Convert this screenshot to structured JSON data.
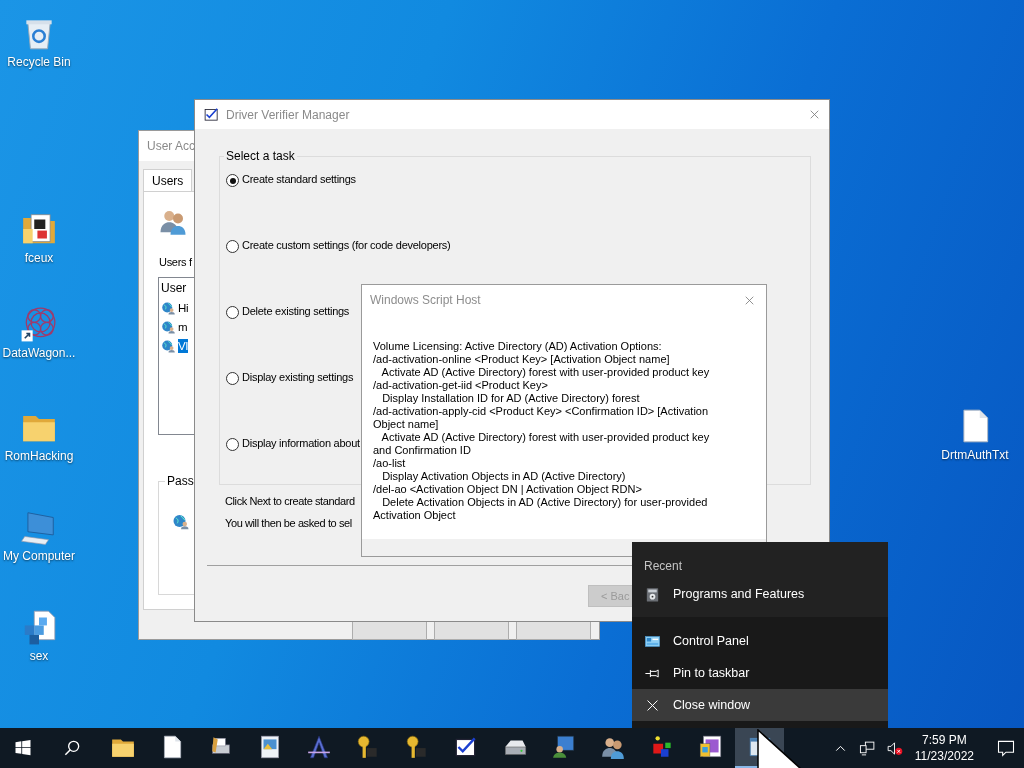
{
  "desktop_icons": [
    {
      "label": "Recycle Bin",
      "kind": "recycle-bin"
    },
    {
      "label": "fceux",
      "kind": "folder-doc"
    },
    {
      "label": "DataWagon...",
      "kind": "web-shortcut"
    },
    {
      "label": "RomHacking",
      "kind": "folder"
    },
    {
      "label": "My Computer",
      "kind": "computer"
    },
    {
      "label": "sex",
      "kind": "registry"
    },
    {
      "label": "DrtmAuthTxt",
      "kind": "file"
    }
  ],
  "user_accounts": {
    "title": "User Acc",
    "tabs": [
      {
        "label": "Users",
        "selected": true
      }
    ],
    "users_label": "Users f",
    "list": {
      "header": "User",
      "rows": [
        {
          "name": "Hi",
          "selected": false
        },
        {
          "name": "m",
          "selected": false
        },
        {
          "name": "VI",
          "selected": true
        }
      ]
    },
    "password_group": "Pass"
  },
  "driver_verifier": {
    "title": "Driver Verifier Manager",
    "group_label": "Select a task",
    "options": [
      {
        "label": "Create standard settings",
        "selected": true
      },
      {
        "label": "Create custom settings (for code developers)",
        "selected": false
      },
      {
        "label": "Delete existing settings",
        "selected": false
      },
      {
        "label": "Display existing settings",
        "selected": false
      },
      {
        "label": "Display information about",
        "selected": false
      }
    ],
    "notes": [
      "Click Next to create standard",
      "You will then be asked to sel"
    ],
    "back_button": {
      "label": "< Bac",
      "disabled": true
    }
  },
  "script_host": {
    "title": "Windows Script Host",
    "message": "Volume Licensing: Active Directory (AD) Activation Options:\n/ad-activation-online <Product Key> [Activation Object name]\n   Activate AD (Active Directory) forest with user-provided product key\n/ad-activation-get-iid <Product Key>\n   Display Installation ID for AD (Active Directory) forest\n/ad-activation-apply-cid <Product Key> <Confirmation ID> [Activation\nObject name]\n   Activate AD (Active Directory) forest with user-provided product key\nand Confirmation ID\n/ao-list\n   Display Activation Objects in AD (Active Directory)\n/del-ao <Activation Object DN | Activation Object RDN>\n   Delete Activation Objects in AD (Active Directory) for user-provided\nActivation Object"
  },
  "jump_list": {
    "heading": "Recent",
    "recent": [
      {
        "label": "Programs and Features",
        "kind": "programs"
      }
    ],
    "tasks": [
      {
        "label": "Control Panel",
        "kind": "control-panel",
        "selected": false
      },
      {
        "label": "Pin to taskbar",
        "kind": "pin",
        "selected": false
      },
      {
        "label": "Close window",
        "kind": "close",
        "selected": true
      }
    ]
  },
  "taskbar": {
    "apps": [
      {
        "kind": "folder",
        "active": false
      },
      {
        "kind": "file",
        "active": false
      },
      {
        "kind": "printer",
        "active": false
      },
      {
        "kind": "picture",
        "active": false
      },
      {
        "kind": "font",
        "active": false
      },
      {
        "kind": "key",
        "active": false
      },
      {
        "kind": "key",
        "active": false
      },
      {
        "kind": "verifier",
        "active": false
      },
      {
        "kind": "drive",
        "active": false
      },
      {
        "kind": "display",
        "active": false
      },
      {
        "kind": "users",
        "active": false
      },
      {
        "kind": "blocks",
        "active": false
      },
      {
        "kind": "paint",
        "active": false
      },
      {
        "kind": "window",
        "active": true
      }
    ],
    "clock": {
      "time": "7:59 PM",
      "date": "11/23/2022"
    }
  }
}
